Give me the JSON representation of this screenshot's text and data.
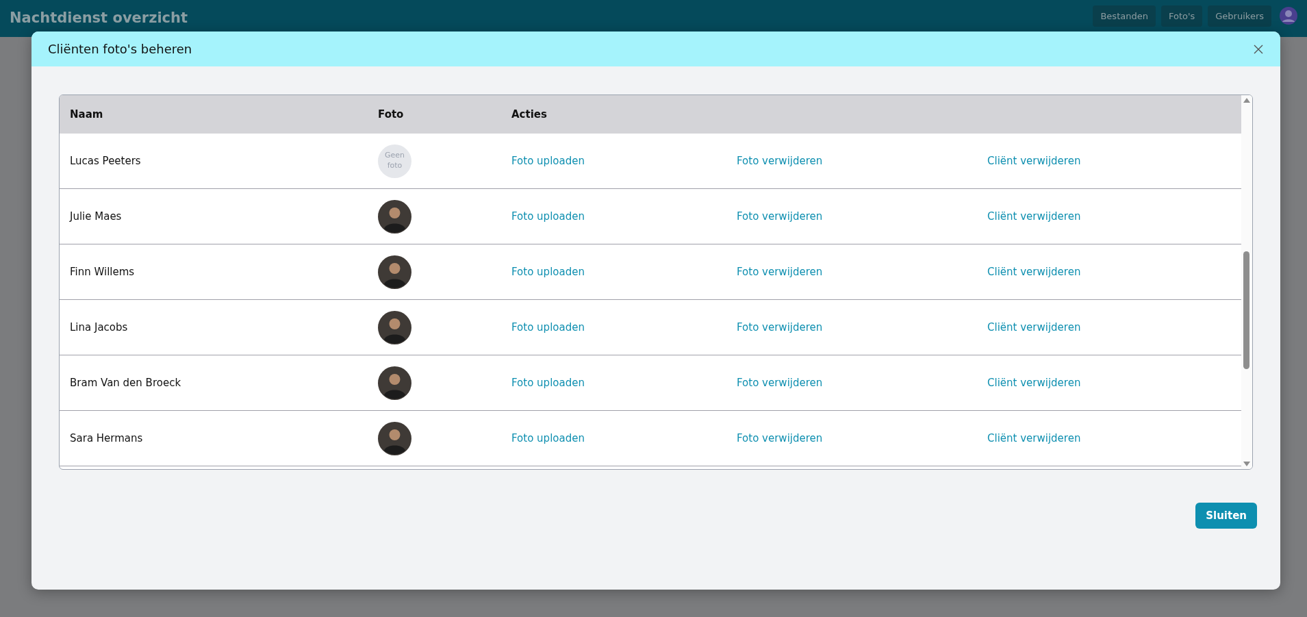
{
  "app_bar": {
    "title": "Nachtdienst overzicht",
    "nav_buttons": [
      "Bestanden",
      "Foto's",
      "Gebruikers"
    ]
  },
  "dialog": {
    "title": "Cliënten foto's beheren",
    "table": {
      "columns": [
        "Naam",
        "Foto",
        "Acties"
      ],
      "rows": [
        {
          "name": "Lucas Peeters",
          "has_photo": false,
          "no_photo_text": "Geen foto",
          "actions": [
            "Foto uploaden",
            "Foto verwijderen",
            "Cliënt verwijderen"
          ]
        },
        {
          "name": "Julie Maes",
          "has_photo": true,
          "actions": [
            "Foto uploaden",
            "Foto verwijderen",
            "Cliënt verwijderen"
          ]
        },
        {
          "name": "Finn Willems",
          "has_photo": true,
          "actions": [
            "Foto uploaden",
            "Foto verwijderen",
            "Cliënt verwijderen"
          ]
        },
        {
          "name": "Lina Jacobs",
          "has_photo": true,
          "actions": [
            "Foto uploaden",
            "Foto verwijderen",
            "Cliënt verwijderen"
          ]
        },
        {
          "name": "Bram Van den Broeck",
          "has_photo": true,
          "actions": [
            "Foto uploaden",
            "Foto verwijderen",
            "Cliënt verwijderen"
          ]
        },
        {
          "name": "Sara Hermans",
          "has_photo": true,
          "actions": [
            "Foto uploaden",
            "Foto verwijderen",
            "Cliënt verwijderen"
          ]
        }
      ]
    },
    "close_button": "Sluiten"
  }
}
